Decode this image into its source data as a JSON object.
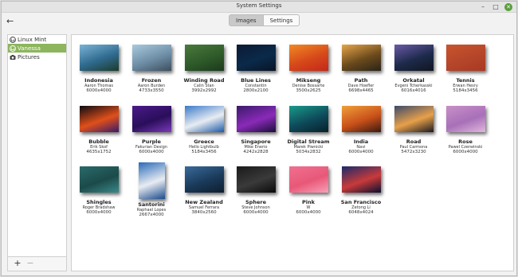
{
  "window": {
    "title": "System Settings"
  },
  "toolbar": {
    "back_icon": "back-arrow-icon",
    "tabs": [
      "Images",
      "Settings"
    ],
    "active_tab": "Images"
  },
  "sidebar": {
    "items": [
      {
        "label": "Linux Mint",
        "icon": "mint-logo-icon"
      },
      {
        "label": "Vanessa",
        "icon": "mint-logo-icon",
        "selected": true
      },
      {
        "label": "Pictures",
        "icon": "camera-icon"
      }
    ],
    "add_label": "+",
    "remove_label": "−"
  },
  "wallpapers": [
    {
      "name": "Indonesia",
      "author": "Aaron Thomas",
      "size": "6000x4000",
      "colors": [
        "#7bb3d6",
        "#2f6a8e",
        "#1d3b2a"
      ]
    },
    {
      "name": "Frozen",
      "author": "Aaron Burden",
      "size": "4733x3550",
      "colors": [
        "#a9c9de",
        "#6e8ea6",
        "#3d4e5e"
      ]
    },
    {
      "name": "Winding Road",
      "author": "Calin Stan",
      "size": "3992x2992",
      "colors": [
        "#4a7a3c",
        "#2f5a2a",
        "#1c3a1c"
      ]
    },
    {
      "name": "Blue Lines",
      "author": "Constantin",
      "size": "2800x2100",
      "colors": [
        "#0c1a33",
        "#0a2a4a",
        "#081426"
      ]
    },
    {
      "name": "Mikseng",
      "author": "Denise Bossarte",
      "size": "3500x2625",
      "colors": [
        "#f08a24",
        "#d6481a",
        "#c4281a"
      ]
    },
    {
      "name": "Path",
      "author": "Dave Hoefler",
      "size": "6698x4465",
      "colors": [
        "#e6a64a",
        "#6b4a1c",
        "#2a2418"
      ]
    },
    {
      "name": "Orkatal",
      "author": "Evgeni Tcherkasski",
      "size": "6016x4016",
      "colors": [
        "#6b5aa8",
        "#1d2a4a",
        "#101620"
      ]
    },
    {
      "name": "Tennis",
      "author": "Erwan Hesry",
      "size": "5184x3456",
      "colors": [
        "#c8552e",
        "#b5452a",
        "#a83a24"
      ]
    },
    {
      "name": "Bubble",
      "author": "Erik Skof",
      "size": "4635x1752",
      "colors": [
        "#0a0a12",
        "#e0501a",
        "#3a1a6a"
      ]
    },
    {
      "name": "Purple",
      "author": "Fakurian Design",
      "size": "6000x4000",
      "colors": [
        "#4a1a8a",
        "#2a0e5a",
        "#7a3ab8"
      ]
    },
    {
      "name": "Greece",
      "author": "Hello Lightbulb",
      "size": "5184x3456",
      "colors": [
        "#3a7ac8",
        "#e8ecf2",
        "#1c5aa8"
      ]
    },
    {
      "name": "Singapore",
      "author": "Mike Enerio",
      "size": "4242x2828",
      "colors": [
        "#3a1a6a",
        "#8a2ab8",
        "#1a0e3a"
      ]
    },
    {
      "name": "Digital Stream",
      "author": "Marek Piwnicki",
      "size": "5034x2832",
      "colors": [
        "#1a9a8a",
        "#0e4a5a",
        "#06202a"
      ]
    },
    {
      "name": "India",
      "author": "Navi",
      "size": "6000x4000",
      "colors": [
        "#f0a03a",
        "#c8501a",
        "#3a1a10"
      ]
    },
    {
      "name": "Road",
      "author": "Paul Carmona",
      "size": "5472x3230",
      "colors": [
        "#3a4a6a",
        "#e8a04a",
        "#1a1a22"
      ]
    },
    {
      "name": "Rose",
      "author": "Pawel Czerwinski",
      "size": "6000x4000",
      "colors": [
        "#c890c8",
        "#a870b8",
        "#e0b8dc"
      ]
    },
    {
      "name": "Shingles",
      "author": "Roger Bradshaw",
      "size": "6000x4000",
      "colors": [
        "#2a6a6a",
        "#1c4a4a",
        "#3a8a8a"
      ]
    },
    {
      "name": "Santorini",
      "author": "Raphael Lopes",
      "size": "2667x4000",
      "colors": [
        "#2a6ab8",
        "#e8ecf2",
        "#1a4a8a"
      ],
      "portrait": true
    },
    {
      "name": "New Zealand",
      "author": "Samuel Ferrara",
      "size": "3840x2560",
      "colors": [
        "#3a6a9a",
        "#1a3a5a",
        "#0e1e2e"
      ]
    },
    {
      "name": "Sphere",
      "author": "Steve Johnson",
      "size": "6000x4000",
      "colors": [
        "#1a1a1a",
        "#3a3a3a",
        "#0a0a0a"
      ]
    },
    {
      "name": "Pink",
      "author": "W",
      "size": "6000x4000",
      "colors": [
        "#f07090",
        "#e85878",
        "#f8a0b8"
      ]
    },
    {
      "name": "San Francisco",
      "author": "Zetong Li",
      "size": "6048x4024",
      "colors": [
        "#1a2a6a",
        "#c83a3a",
        "#0a1030"
      ]
    }
  ]
}
